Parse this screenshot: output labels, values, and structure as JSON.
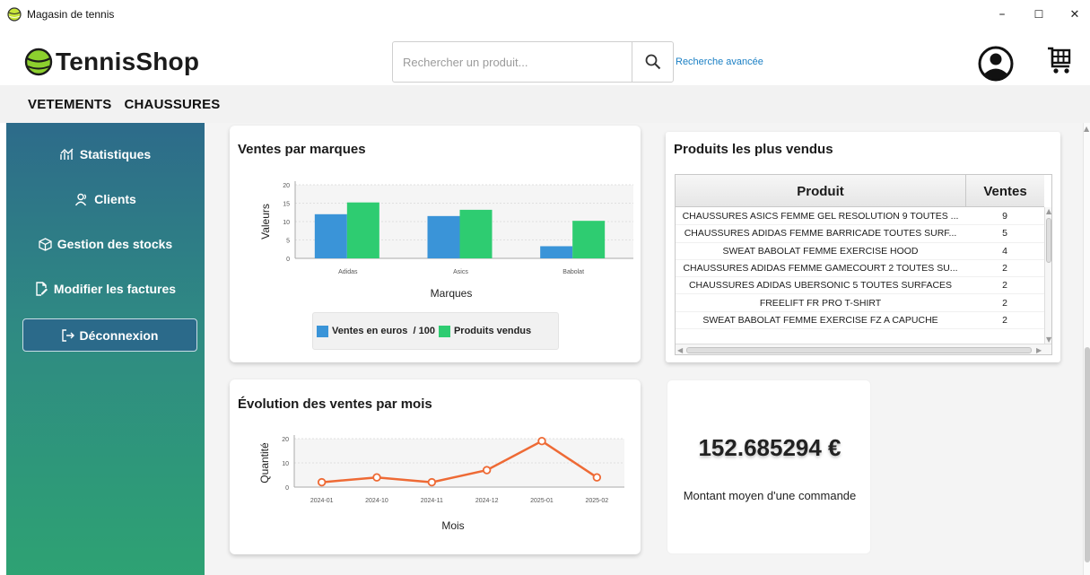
{
  "window": {
    "title": "Magasin de tennis",
    "minimize": "–",
    "maximize": "☐",
    "close": "✕"
  },
  "header": {
    "logo_text": "TennisShop",
    "search_placeholder": "Rechercher un produit...",
    "advanced_search": "Recherche avancée"
  },
  "categories": [
    "VETEMENTS",
    "CHAUSSURES"
  ],
  "sidebar": {
    "items": [
      {
        "label": "Statistiques",
        "icon": "chart-icon"
      },
      {
        "label": "Clients",
        "icon": "users-icon"
      },
      {
        "label": "Gestion des stocks",
        "icon": "box-icon"
      },
      {
        "label": "Modifier les factures",
        "icon": "edit-document-icon"
      }
    ],
    "logout": "Déconnexion"
  },
  "colors": {
    "blue_series": "#3a94d8",
    "green_series": "#2ecc71",
    "line_series": "#ee6a35"
  },
  "sales_by_brand": {
    "title": "Ventes par marques",
    "legend_euros": "Ventes en euros  / 100",
    "legend_products": "Produits vendus"
  },
  "monthly_sales": {
    "title": "Évolution des ventes par mois"
  },
  "top_products": {
    "title": "Produits les plus vendus",
    "columns": [
      "Produit",
      "Ventes"
    ],
    "rows": [
      [
        "CHAUSSURES ASICS FEMME GEL RESOLUTION 9 TOUTES ...",
        "9"
      ],
      [
        "CHAUSSURES ADIDAS FEMME BARRICADE TOUTES SURF...",
        "5"
      ],
      [
        "SWEAT BABOLAT FEMME EXERCISE HOOD",
        "4"
      ],
      [
        "CHAUSSURES ADIDAS FEMME GAMECOURT 2 TOUTES SU...",
        "2"
      ],
      [
        "CHAUSSURES ADIDAS UBERSONIC 5 TOUTES SURFACES",
        "2"
      ],
      [
        "FREELIFT FR PRO T-SHIRT",
        "2"
      ],
      [
        "SWEAT BABOLAT FEMME EXERCISE FZ A CAPUCHE",
        "2"
      ]
    ]
  },
  "average_order": {
    "amount": "152.685294 €",
    "label": "Montant moyen d'une commande"
  },
  "chart_data": [
    {
      "type": "bar",
      "title": "Ventes par marques",
      "xlabel": "Marques",
      "ylabel": "Valeurs",
      "categories": [
        "Adidas",
        "Asics",
        "Babolat"
      ],
      "series": [
        {
          "name": "Ventes en euros  / 100",
          "values": [
            12,
            11.5,
            3.3
          ]
        },
        {
          "name": "Produits vendus",
          "values": [
            15.2,
            13.2,
            10.2
          ]
        }
      ],
      "ylim": [
        0,
        20
      ],
      "yticks": [
        0,
        5,
        10,
        15,
        20
      ],
      "grid": true,
      "legend": "bottom"
    },
    {
      "type": "line",
      "title": "Évolution des ventes par mois",
      "xlabel": "Mois",
      "ylabel": "Quantité",
      "categories": [
        "2024-01",
        "2024-10",
        "2024-11",
        "2024-12",
        "2025-01",
        "2025-02"
      ],
      "series": [
        {
          "values": [
            2,
            4,
            2,
            7,
            19,
            4
          ]
        }
      ],
      "ylim": [
        0,
        20
      ],
      "yticks": [
        0,
        10,
        20
      ],
      "grid": true
    }
  ]
}
